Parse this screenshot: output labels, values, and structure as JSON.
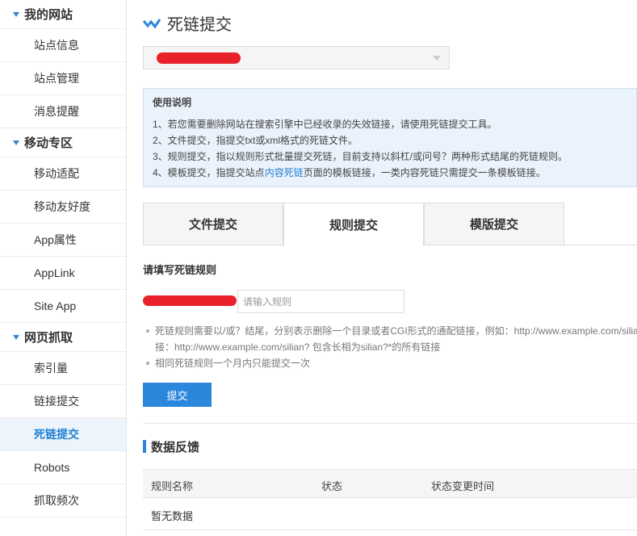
{
  "sidebar": {
    "groups": [
      {
        "label": "我的网站",
        "items": [
          "站点信息",
          "站点管理",
          "消息提醒"
        ]
      },
      {
        "label": "移动专区",
        "items": [
          "移动适配",
          "移动友好度",
          "App属性",
          "AppLink",
          "Site App"
        ]
      },
      {
        "label": "网页抓取",
        "items": [
          "索引量",
          "链接提交",
          "死链提交",
          "Robots",
          "抓取频次"
        ]
      }
    ],
    "active_item": "死链提交"
  },
  "page": {
    "title": "死链提交",
    "site_select_value": "•••••••"
  },
  "guide": {
    "heading": "使用说明",
    "line1": "1、若您需要删除网站在搜索引擎中已经收录的失效链接，请使用死链提交工具。",
    "line2": "2、文件提交，指提交txt或xml格式的死链文件。",
    "line3": "3、规则提交，指以规则形式批量提交死链，目前支持以斜杠/或问号？两种形式结尾的死链规则。",
    "line4_pre": "4、模板提交，指提交站点",
    "line4_link": "内容死链",
    "line4_post": "页面的模板链接，一类内容死链只需提交一条模板链接。"
  },
  "tabs": [
    "文件提交",
    "规则提交",
    "模版提交"
  ],
  "active_tab": 1,
  "form": {
    "heading": "请填写死链规则",
    "rule_placeholder": "请输入规则",
    "note1_line1": "死链规则需要以/或？结尾，分别表示删除一个目录或者CGI形式的通配链接，例如：http://www.example.com/silian/",
    "note1_line2": "接：http://www.example.com/silian? 包含长相为silian?*的所有链接",
    "note2": "相同死链规则一个月内只能提交一次",
    "submit_label": "提交"
  },
  "feedback": {
    "heading": "数据反馈",
    "columns": [
      "规则名称",
      "状态",
      "状态变更时间"
    ],
    "empty_text": "暂无数据"
  },
  "colors": {
    "accent": "#2b87dc",
    "redaction": "#e8212a"
  }
}
